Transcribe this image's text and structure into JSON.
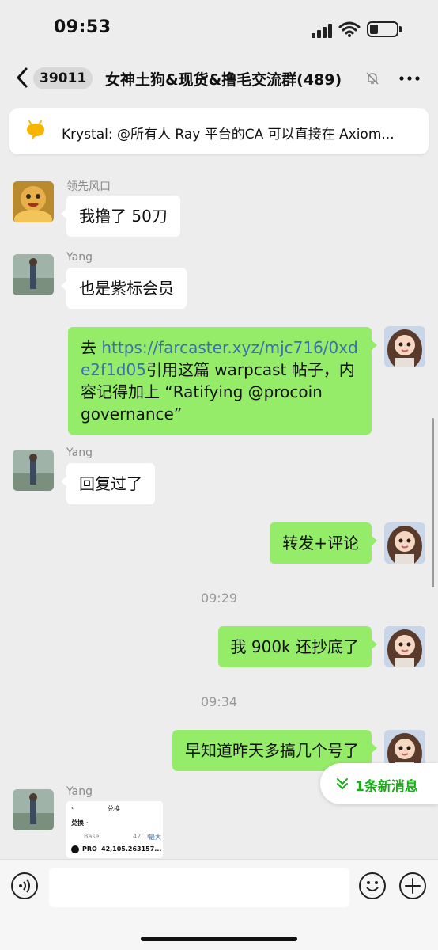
{
  "status_bar": {
    "time": "09:53"
  },
  "nav": {
    "unread_count": "39011",
    "title": "女神土狗&现货&撸毛交流群(489)"
  },
  "pinned": {
    "text": "Krystal: @所有人  Ray 平台的CA 可以直接在 Axiom..."
  },
  "messages": [
    {
      "sender": "领先风口",
      "text": "我撸了 50刀"
    },
    {
      "sender": "Yang",
      "text": "也是紫标会员"
    },
    {
      "prefix": "去 ",
      "link": "https://farcaster.xyz/mjc716/0xde2f1d05",
      "suffix": "引用这篇 warpcast 帖子，内容记得加上 “Ratifying @procoin governance”"
    },
    {
      "sender": "Yang",
      "text": "回复过了"
    },
    {
      "text": "转发+评论"
    },
    {
      "time": "09:29"
    },
    {
      "text": "我 900k 还抄底了"
    },
    {
      "time": "09:34"
    },
    {
      "text": "早知道昨天多搞几个号了"
    },
    {
      "sender": "Yang"
    }
  ],
  "image_preview": {
    "title": "兑换",
    "subtitle": "兑换 ·",
    "chain": "Base",
    "balance": "42.1K",
    "max": "最大",
    "token": "PRO",
    "amount": "42,105.263157..."
  },
  "new_messages": {
    "label": "1条新消息"
  },
  "colors": {
    "accent": "#1aad19",
    "outgoing_bubble": "#95ec69",
    "link": "#3a6fb0"
  }
}
